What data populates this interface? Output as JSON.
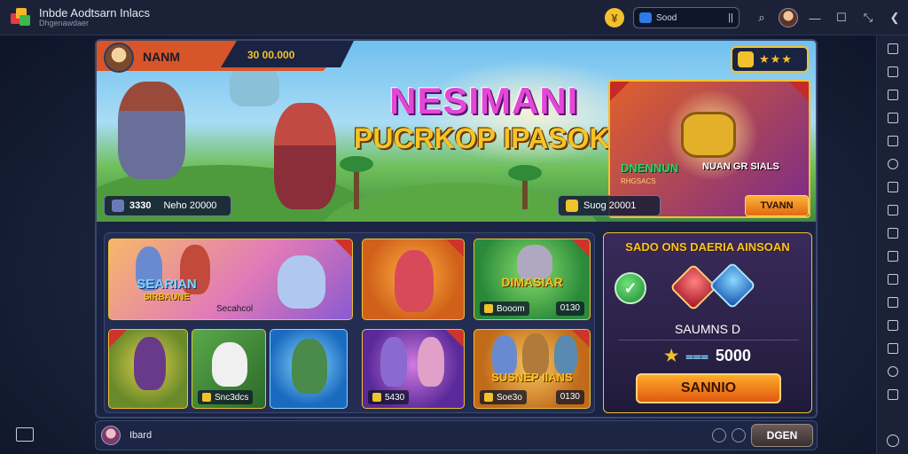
{
  "app": {
    "title": "Inbde Aodtsarn Inlacs",
    "subtitle": "Dhgenawdaer"
  },
  "titlebar": {
    "search_value": "Sood",
    "search_cursor": "||"
  },
  "header": {
    "player_name": "NANM",
    "player_score": "30 00.000",
    "stars": "★★★"
  },
  "banner": {
    "title": "NESIMANI",
    "subtitle": "PUCRKOP IPASOKAIS",
    "pill_left_score": "3330",
    "pill_left_label": "Neho 20000",
    "promo_title": "DNENNUN",
    "promo_sub": "NUAN GR SIALS",
    "promo_sub2": "RHGSACS",
    "pill_right_label": "Suog 20001",
    "cta_label": "TVANN"
  },
  "cards": [
    {
      "title": "SEARIAN",
      "subtitle": "SIRBAUNE",
      "label": "Secahcol",
      "label2": ""
    },
    {
      "title": "",
      "subtitle": "",
      "label": "",
      "label2": ""
    },
    {
      "title": "DIMASIAR",
      "subtitle": "",
      "label": "Booom",
      "label2": "0130"
    },
    {
      "title": "",
      "subtitle": "",
      "label": "Snc3dcs",
      "label2": ""
    },
    {
      "title": "",
      "subtitle": "",
      "label": "",
      "label2": ""
    },
    {
      "title": "",
      "subtitle": "",
      "label": "5430",
      "label2": ""
    },
    {
      "title": "SUSNEP IIANS",
      "subtitle": "",
      "label": "Soe3o",
      "label2": "0130"
    }
  ],
  "offer": {
    "title": "SADO ONS DAERIA AINSOAN",
    "name": "SAUMNS D",
    "price": "5000",
    "button": "SANNIO"
  },
  "bottombar": {
    "name": "Ibard",
    "button": "DGEN"
  },
  "colors": {
    "accent": "#f2c12e",
    "title_pink": "#e447d8",
    "cta_orange": "#e06a12"
  }
}
